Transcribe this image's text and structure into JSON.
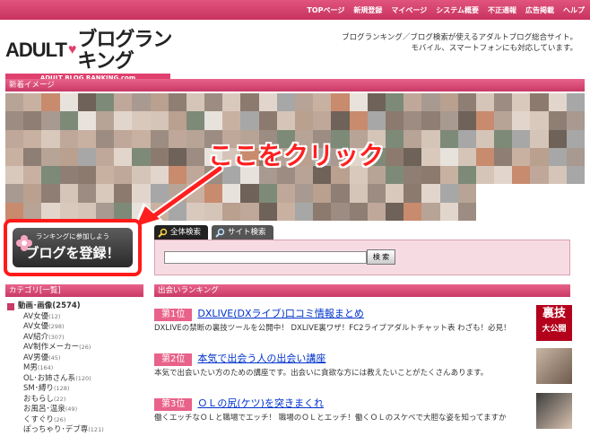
{
  "topnav": [
    "TOPページ",
    "新規登録",
    "マイページ",
    "システム概要",
    "不正通報",
    "広告掲載",
    "ヘルプ"
  ],
  "logo": {
    "main": "ADULT",
    "main2": "ブログランキング",
    "sub": "ADULT BLOG RANKING.com"
  },
  "tagline": [
    "ブログランキング／ブログ検索が使えるアダルトブログ総合サイト。",
    "モバイル、スマートフォンにも対応しています。"
  ],
  "new_images_label": "新着イメージ",
  "callout": "ここをクリック",
  "register": {
    "small": "ランキングに参加しよう",
    "big": "ブログを登録！"
  },
  "tabs": [
    "全体検索",
    "サイト検索"
  ],
  "search": {
    "button": "検 索",
    "value": ""
  },
  "category_label": "カテゴリ[一覧]",
  "categories": {
    "head": "動画･画像",
    "head_count": "(2574)",
    "items": [
      {
        "name": "AV女優",
        "count": "(12)"
      },
      {
        "name": "AV女優",
        "count": "(298)"
      },
      {
        "name": "AV紹介",
        "count": "(307)"
      },
      {
        "name": "AV制作メーカー",
        "count": "(26)"
      },
      {
        "name": "AV男優",
        "count": "(45)"
      },
      {
        "name": "M男",
        "count": "(164)"
      },
      {
        "name": "OL･お姉さん系",
        "count": "(120)"
      },
      {
        "name": "SM･縛り",
        "count": "(128)"
      },
      {
        "name": "おもらし",
        "count": "(22)"
      },
      {
        "name": "お風呂･温泉",
        "count": "(49)"
      },
      {
        "name": "くすぐり",
        "count": "(26)"
      },
      {
        "name": "ぽっちゃり･デブ専",
        "count": "(121)"
      }
    ]
  },
  "ranking_label": "出会いランキング",
  "entries": [
    {
      "rank": "第1位",
      "title": "DXLIVE(DXライブ)口コミ情報まとめ",
      "desc": "DXLIVEの禁断の裏技ツールを公開中！ DXLIVE裏ワザ！FC2ライブアダルトチャット表 わざも！必見！",
      "badge": [
        "裏技",
        "大公開"
      ]
    },
    {
      "rank": "第2位",
      "title": "本気で出会う人の出会い講座",
      "desc": "本気で出会いたい方のための講座です。出会いに貪欲な方には教えたいことがたくさんあります。"
    },
    {
      "rank": "第3位",
      "title": "ＯＬの尻(ケツ)を突きまくれ",
      "desc": "働くエッチなＯＬと職場でエッチ！ 職場のＯＬとエッチ！働くＯＬのスケベで大胆な姿を知ってますか"
    }
  ],
  "colors": {
    "accent": "#c93a66",
    "callout": "#ff1f1f",
    "link": "#0033cc"
  }
}
